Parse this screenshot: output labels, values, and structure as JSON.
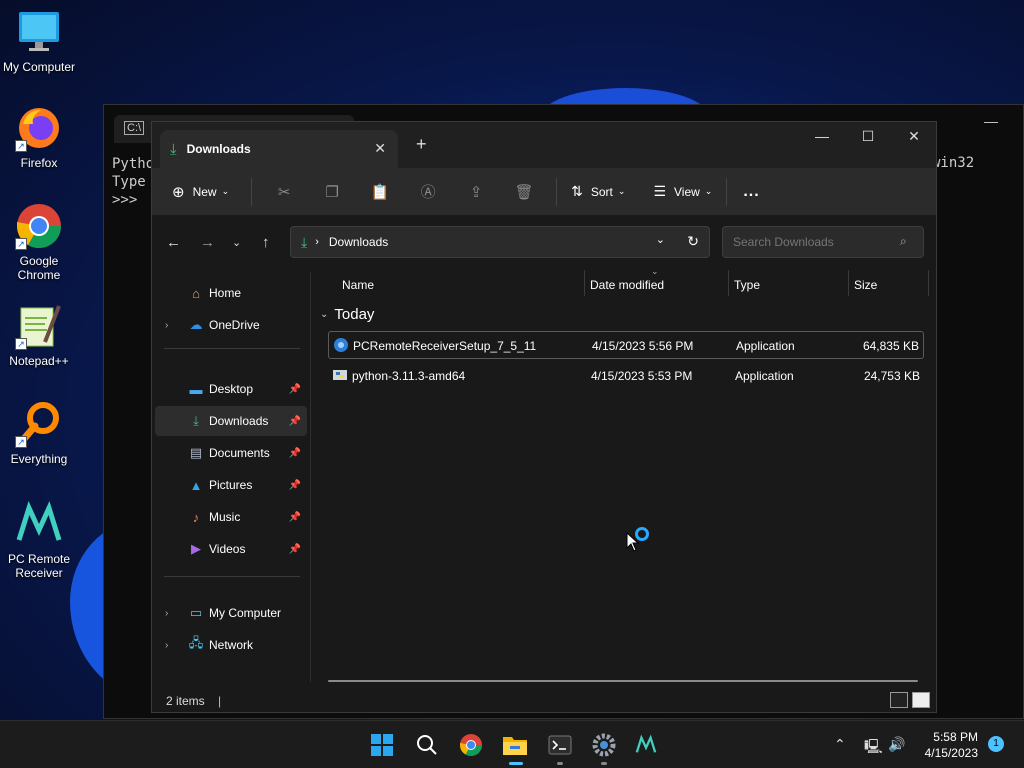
{
  "desktop": {
    "icons": [
      {
        "label": "My Computer",
        "icon": "monitor-icon"
      },
      {
        "label": "Firefox",
        "icon": "firefox-icon"
      },
      {
        "label": "Google Chrome",
        "icon": "chrome-icon"
      },
      {
        "label": "Notepad++",
        "icon": "notepadpp-icon"
      },
      {
        "label": "Everything",
        "icon": "everything-icon"
      },
      {
        "label": "PC Remote Receiver",
        "icon": "pc-remote-icon"
      }
    ]
  },
  "terminal": {
    "lines": [
      "Pytho",
      "Type",
      ">>>"
    ],
    "right_text": "win32"
  },
  "explorer": {
    "tab_title": "Downloads",
    "toolbar": {
      "new_label": "New",
      "sort_label": "Sort",
      "view_label": "View",
      "more_label": "..."
    },
    "address": {
      "crumb": "Downloads",
      "search_placeholder": "Search Downloads"
    },
    "sidebar": {
      "home": "Home",
      "onedrive": "OneDrive",
      "desktop": "Desktop",
      "downloads": "Downloads",
      "documents": "Documents",
      "pictures": "Pictures",
      "music": "Music",
      "videos": "Videos",
      "my_computer": "My Computer",
      "network": "Network"
    },
    "columns": {
      "name": "Name",
      "date": "Date modified",
      "type": "Type",
      "size": "Size"
    },
    "group_label": "Today",
    "files": [
      {
        "name": "PCRemoteReceiverSetup_7_5_11",
        "date": "4/15/2023 5:56 PM",
        "type": "Application",
        "size": "64,835 KB"
      },
      {
        "name": "python-3.11.3-amd64",
        "date": "4/15/2023 5:53 PM",
        "type": "Application",
        "size": "24,753 KB"
      }
    ],
    "status": "2 items"
  },
  "taskbar": {
    "time": "5:58 PM",
    "date": "4/15/2023",
    "notification_count": "1"
  },
  "colors": {
    "accent": "#4cc2ff",
    "download_green": "#3fbf7f"
  }
}
